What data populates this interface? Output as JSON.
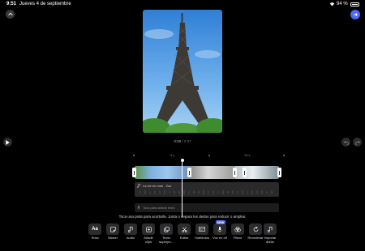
{
  "status_bar": {
    "time": "9:51",
    "date": "Jueves 4 de septiembre",
    "battery": "94 %"
  },
  "icons": {
    "collapse": "chevron-up-icon",
    "done": "arrow-right-icon",
    "play": "play-icon",
    "undo": "undo-icon",
    "redo": "redo-icon"
  },
  "colors": {
    "accent": "#4a6cf7",
    "audio_track": "#2a2a2a",
    "playhead": "#ffffff"
  },
  "player": {
    "current_time": "0:00",
    "separator": "/",
    "total_time": "0:37"
  },
  "ruler": {
    "labels": [
      "5 s",
      "15 s"
    ]
  },
  "tracks": {
    "audio_label": "La vie en rose - Zaz",
    "voice_label": "Toca para añadir texto"
  },
  "hint": "Toca una pista para acortarla. Junta o separa los dedos para reducir o ampliar.",
  "toolbar": [
    {
      "label": "Texto",
      "icon": "text-icon"
    },
    {
      "label": "Sticker",
      "icon": "sticker-icon"
    },
    {
      "label": "Audio",
      "icon": "music-note-icon"
    },
    {
      "label": "Añadir\nclips",
      "icon": "add-clip-icon"
    },
    {
      "label": "Texto\nsuperpu...",
      "icon": "overlay-icon"
    },
    {
      "label": "Editar",
      "icon": "scissors-icon"
    },
    {
      "label": "Subtítulos",
      "icon": "captions-icon"
    },
    {
      "label": "Voz en off",
      "icon": "microphone-icon",
      "badge": "NEW"
    },
    {
      "label": "Filtrar",
      "icon": "filter-icon"
    },
    {
      "label": "Reordenar",
      "icon": "reorder-icon"
    },
    {
      "label": "Importar\naudio",
      "icon": "import-audio-icon"
    }
  ]
}
